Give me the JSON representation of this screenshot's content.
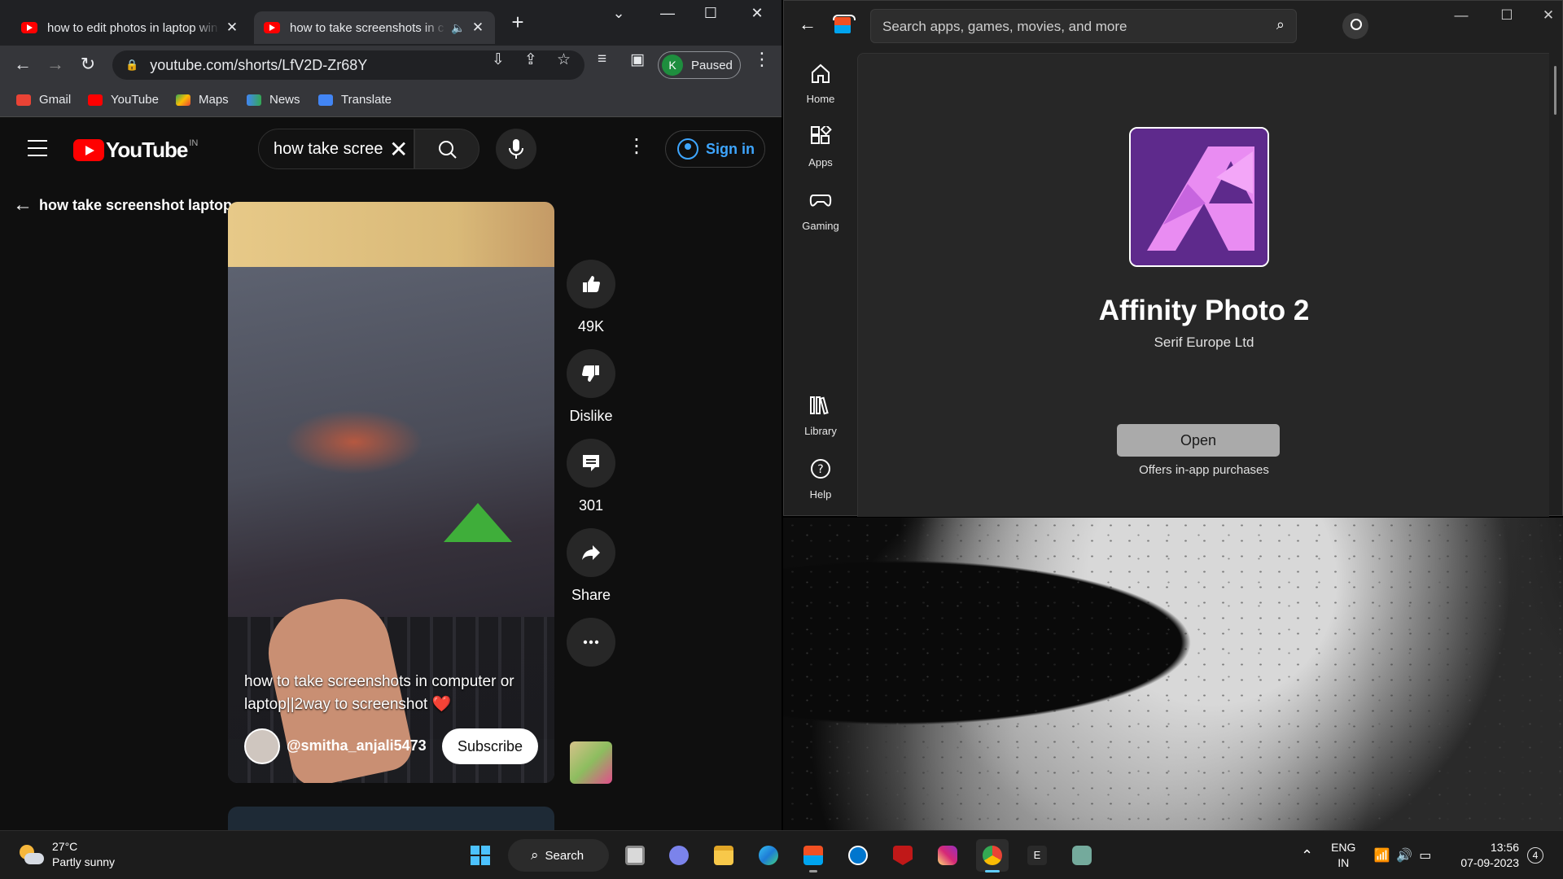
{
  "chrome": {
    "tabs": [
      {
        "title": "how to edit photos in laptop win",
        "close": "✕"
      },
      {
        "title": "how to take screenshots in c",
        "close": "✕",
        "audio": "🔈"
      }
    ],
    "new_tab": "+",
    "url": "youtube.com/shorts/LfV2D-Zr68Y",
    "profile_initial": "K",
    "profile_status": "Paused",
    "bookmarks": [
      {
        "label": "Gmail",
        "color": "#ea4335"
      },
      {
        "label": "YouTube",
        "color": "#ff0000"
      },
      {
        "label": "Maps",
        "color": "#34a853"
      },
      {
        "label": "News",
        "color": "#4285f4"
      },
      {
        "label": "Translate",
        "color": "#4285f4"
      }
    ]
  },
  "youtube": {
    "logo_text": "YouTube",
    "country": "IN",
    "search_query": "how take screenshot laptop",
    "sign_in": "Sign in",
    "back_title": "how take screenshot laptop",
    "short": {
      "caption": "how to take screenshots in computer or laptop||2way to screenshot",
      "heart": "❤️",
      "channel": "@smitha_anjali5473",
      "subscribe": "Subscribe"
    },
    "actions": {
      "likes": "49K",
      "dislike": "Dislike",
      "comments": "301",
      "share": "Share"
    }
  },
  "store": {
    "search_placeholder": "Search apps, games, movies, and more",
    "nav": [
      {
        "label": "Home",
        "icon": "home-icon"
      },
      {
        "label": "Apps",
        "icon": "apps-icon"
      },
      {
        "label": "Gaming",
        "icon": "gaming-icon"
      },
      {
        "label": "Library",
        "icon": "library-icon"
      },
      {
        "label": "Help",
        "icon": "help-icon"
      }
    ],
    "app_name": "Affinity Photo 2",
    "publisher": "Serif Europe Ltd",
    "open_button": "Open",
    "offers": "Offers in-app purchases"
  },
  "taskbar": {
    "weather_temp": "27°C",
    "weather_desc": "Partly sunny",
    "search": "Search",
    "lang": "ENG",
    "region": "IN",
    "time": "13:56",
    "date": "07-09-2023",
    "notifications": "4"
  }
}
